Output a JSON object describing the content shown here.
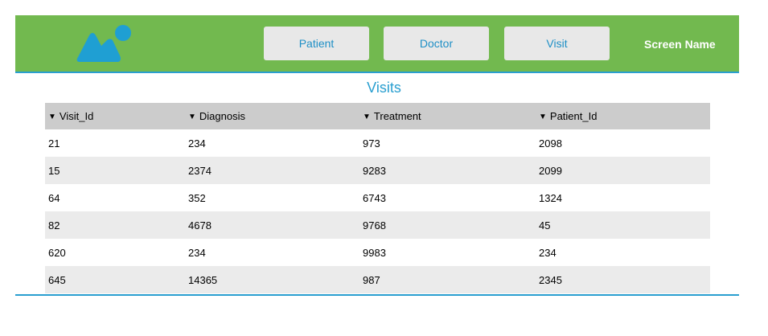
{
  "header": {
    "nav": {
      "patient_label": "Patient",
      "doctor_label": "Doctor",
      "visit_label": "Visit"
    },
    "screen_name": "Screen Name",
    "logo_icon": "image-placeholder-icon"
  },
  "main": {
    "title": "Visits",
    "table": {
      "columns": [
        "Visit_Id",
        "Diagnosis",
        "Treatment",
        "Patient_Id"
      ],
      "sort_icon": "▼",
      "rows": [
        [
          "21",
          "234",
          "973",
          "2098"
        ],
        [
          "15",
          "2374",
          "9283",
          "2099"
        ],
        [
          "64",
          "352",
          "6743",
          "1324"
        ],
        [
          "82",
          "4678",
          "9768",
          "45"
        ],
        [
          "620",
          "234",
          "9983",
          "234"
        ],
        [
          "645",
          "14365",
          "987",
          "2345"
        ]
      ]
    }
  },
  "colors": {
    "header_bg": "#72b94f",
    "accent": "#2a9fd0",
    "button_bg": "#e8e8e8",
    "header_row_bg": "#cccccc",
    "stripe_bg": "#ebebeb"
  }
}
